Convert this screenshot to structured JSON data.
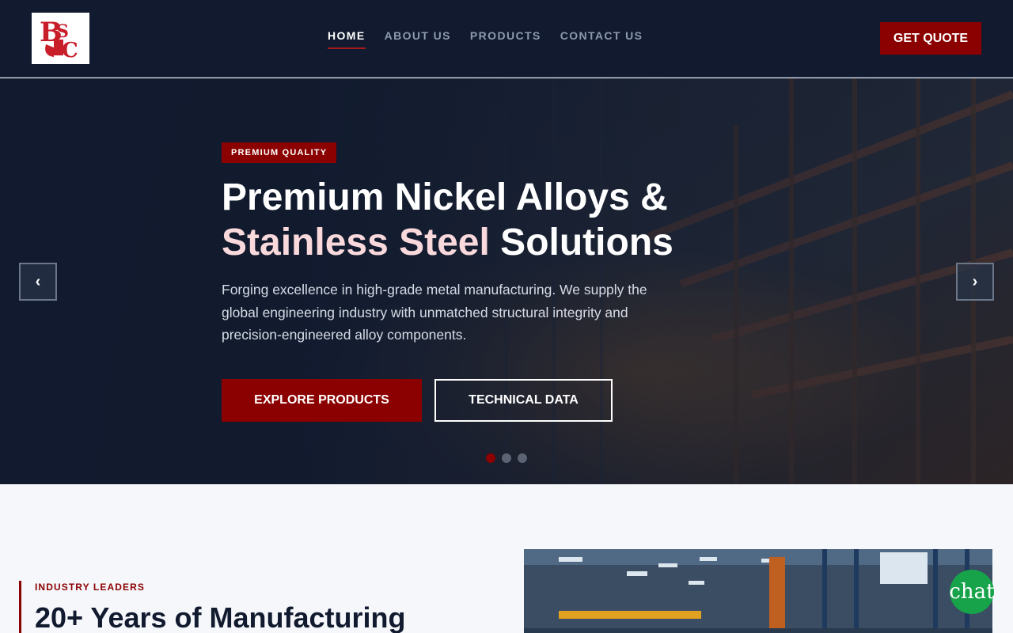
{
  "logo": {
    "text": "BSC",
    "icon": "bsc-logo-icon"
  },
  "nav": {
    "items": [
      {
        "label": "HOME",
        "active": true
      },
      {
        "label": "ABOUT US",
        "active": false
      },
      {
        "label": "PRODUCTS",
        "active": false
      },
      {
        "label": "CONTACT US",
        "active": false
      }
    ],
    "cta": "GET QUOTE"
  },
  "hero": {
    "badge": "PREMIUM QUALITY",
    "title_line1": "Premium Nickel Alloys &",
    "title_highlight": "Stainless Steel",
    "title_rest": " Solutions",
    "description": "Forging excellence in high-grade metal manufacturing. We supply the global engineering industry with unmatched structural integrity and precision-engineered alloy components.",
    "primary_button": "EXPLORE PRODUCTS",
    "secondary_button": "TECHNICAL DATA",
    "prev_arrow": "‹",
    "next_arrow": "›",
    "slides": 3,
    "active_slide": 1
  },
  "about": {
    "eyebrow": "INDUSTRY LEADERS",
    "title": "20+ Years of Manufacturing"
  },
  "chat": {
    "label": "chat"
  },
  "colors": {
    "brand_red": "#8b0000",
    "navy": "#111a2e",
    "highlight": "#fad9dc",
    "chat_green": "#16a34a"
  }
}
